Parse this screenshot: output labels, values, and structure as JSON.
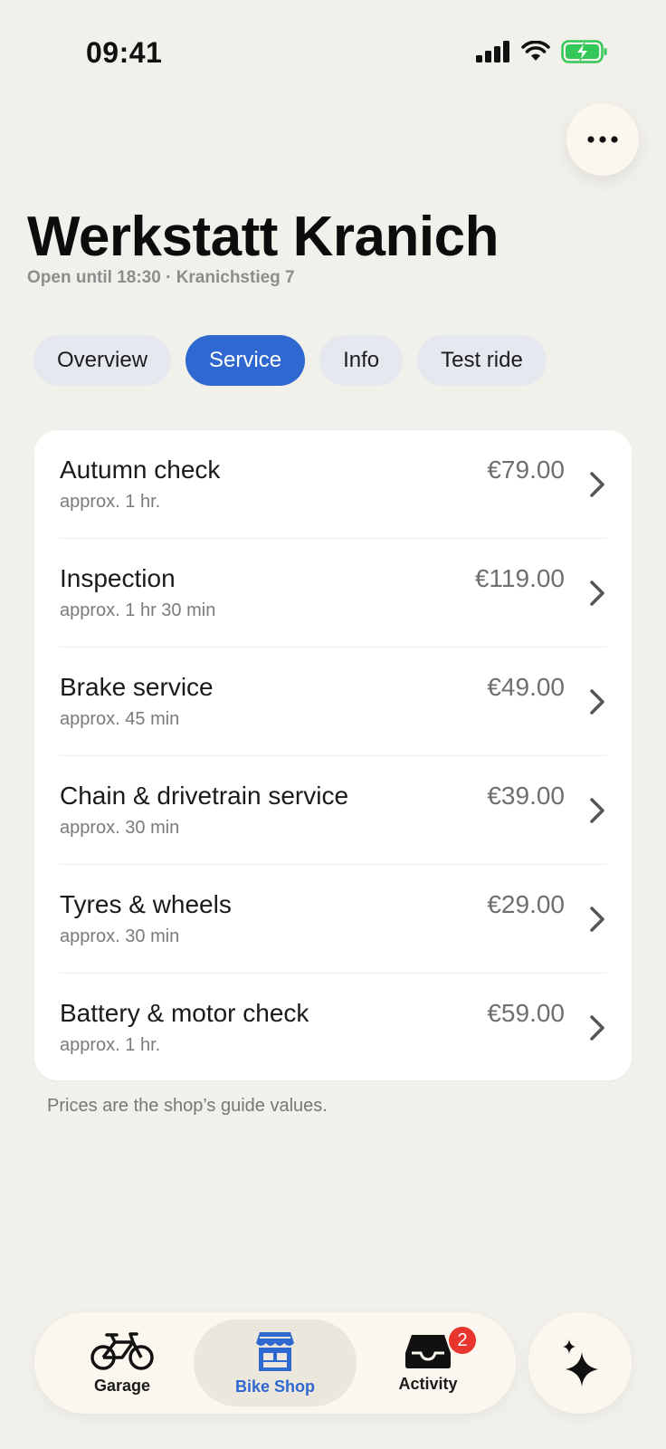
{
  "status_bar": {
    "time": "09:41",
    "icons": [
      "cellular-signal-icon",
      "wifi-icon",
      "battery-charging-icon"
    ],
    "battery_color": "#34c759"
  },
  "header": {
    "more_icon": "ellipsis-icon",
    "title": "Werkstatt Kranich",
    "subtitle": "Open until 18:30 · Kranichstieg 7"
  },
  "tabs": [
    {
      "label": "Overview",
      "active": false
    },
    {
      "label": "Service",
      "active": true
    },
    {
      "label": "Info",
      "active": false
    },
    {
      "label": "Test ride",
      "active": false
    }
  ],
  "services": [
    {
      "name": "Autumn check",
      "duration": "approx. 1 hr.",
      "price": "€79.00"
    },
    {
      "name": "Inspection",
      "duration": "approx. 1 hr 30 min",
      "price": "€119.00"
    },
    {
      "name": "Brake service",
      "duration": "approx. 45 min",
      "price": "€49.00"
    },
    {
      "name": "Chain & drivetrain service",
      "duration": "approx. 30 min",
      "price": "€39.00"
    },
    {
      "name": "Tyres & wheels",
      "duration": "approx. 30 min",
      "price": "€29.00"
    },
    {
      "name": "Battery & motor check",
      "duration": "approx. 1 hr.",
      "price": "€59.00"
    }
  ],
  "footnote": "Prices are the shop’s guide values.",
  "nav": {
    "items": [
      {
        "label": "Garage",
        "icon": "bicycle-icon",
        "active": false
      },
      {
        "label": "Bike Shop",
        "icon": "storefront-icon",
        "active": true
      },
      {
        "label": "Activity",
        "icon": "inbox-tray-icon",
        "active": false,
        "badge": "2"
      }
    ],
    "assistant_icon": "sparkles-icon"
  },
  "colors": {
    "accent": "#2f68d0",
    "background": "#f1f0ea",
    "badge": "#e8352d"
  }
}
